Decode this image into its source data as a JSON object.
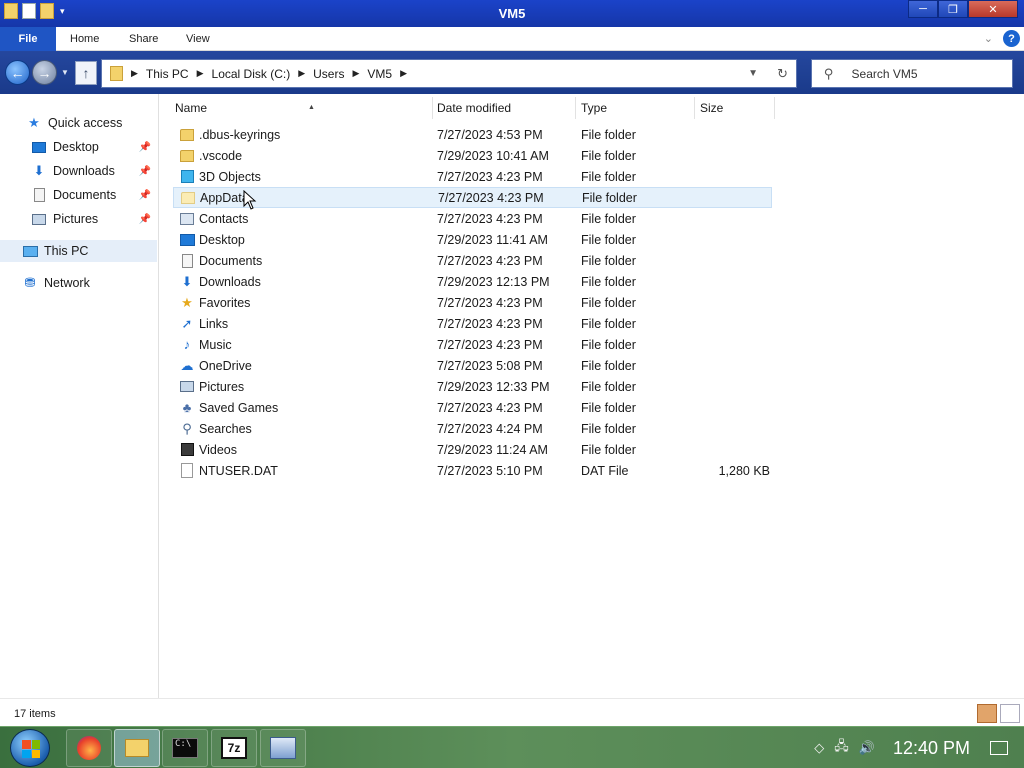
{
  "window": {
    "title": "VM5",
    "minimize_label": "─",
    "restore_label": "❐",
    "close_label": "✕"
  },
  "ribbon": {
    "tabs": [
      "File",
      "Home",
      "Share",
      "View"
    ],
    "collapse_icon": "chevron-down-icon",
    "help_label": "?"
  },
  "address": {
    "crumbs": [
      "This PC",
      "Local Disk (C:)",
      "Users",
      "VM5"
    ]
  },
  "search": {
    "placeholder": "Search VM5"
  },
  "nav": {
    "quick_access": "Quick access",
    "items": [
      {
        "label": "Desktop",
        "icon": "desktop-icon",
        "pinned": true
      },
      {
        "label": "Downloads",
        "icon": "download-icon",
        "pinned": true
      },
      {
        "label": "Documents",
        "icon": "documents-icon",
        "pinned": true
      },
      {
        "label": "Pictures",
        "icon": "pictures-icon",
        "pinned": true
      }
    ],
    "this_pc": "This PC",
    "network": "Network"
  },
  "columns": [
    "Name",
    "Date modified",
    "Type",
    "Size"
  ],
  "files": [
    {
      "name": ".dbus-keyrings",
      "date": "7/27/2023 4:53 PM",
      "type": "File folder",
      "size": "",
      "icon": "folder-icon"
    },
    {
      "name": ".vscode",
      "date": "7/29/2023 10:41 AM",
      "type": "File folder",
      "size": "",
      "icon": "folder-icon"
    },
    {
      "name": "3D Objects",
      "date": "7/27/2023 4:23 PM",
      "type": "File folder",
      "size": "",
      "icon": "3d-objects-icon"
    },
    {
      "name": "AppData",
      "date": "7/27/2023 4:23 PM",
      "type": "File folder",
      "size": "",
      "icon": "folder-icon"
    },
    {
      "name": "Contacts",
      "date": "7/27/2023 4:23 PM",
      "type": "File folder",
      "size": "",
      "icon": "contacts-icon"
    },
    {
      "name": "Desktop",
      "date": "7/29/2023 11:41 AM",
      "type": "File folder",
      "size": "",
      "icon": "desktop-icon"
    },
    {
      "name": "Documents",
      "date": "7/27/2023 4:23 PM",
      "type": "File folder",
      "size": "",
      "icon": "documents-icon"
    },
    {
      "name": "Downloads",
      "date": "7/29/2023 12:13 PM",
      "type": "File folder",
      "size": "",
      "icon": "download-icon"
    },
    {
      "name": "Favorites",
      "date": "7/27/2023 4:23 PM",
      "type": "File folder",
      "size": "",
      "icon": "favorites-icon"
    },
    {
      "name": "Links",
      "date": "7/27/2023 4:23 PM",
      "type": "File folder",
      "size": "",
      "icon": "links-icon"
    },
    {
      "name": "Music",
      "date": "7/27/2023 4:23 PM",
      "type": "File folder",
      "size": "",
      "icon": "music-icon"
    },
    {
      "name": "OneDrive",
      "date": "7/27/2023 5:08 PM",
      "type": "File folder",
      "size": "",
      "icon": "onedrive-icon"
    },
    {
      "name": "Pictures",
      "date": "7/29/2023 12:33 PM",
      "type": "File folder",
      "size": "",
      "icon": "pictures-icon"
    },
    {
      "name": "Saved Games",
      "date": "7/27/2023 4:23 PM",
      "type": "File folder",
      "size": "",
      "icon": "saved-games-icon"
    },
    {
      "name": "Searches",
      "date": "7/27/2023 4:24 PM",
      "type": "File folder",
      "size": "",
      "icon": "search-icon"
    },
    {
      "name": "Videos",
      "date": "7/29/2023 11:24 AM",
      "type": "File folder",
      "size": "",
      "icon": "videos-icon"
    },
    {
      "name": "NTUSER.DAT",
      "date": "7/27/2023 5:10 PM",
      "type": "DAT File",
      "size": "1,280 KB",
      "icon": "file-icon"
    }
  ],
  "status": {
    "item_count": "17 items"
  },
  "taskbar": {
    "apps": [
      {
        "name": "firefox",
        "active": false
      },
      {
        "name": "file-explorer",
        "active": true
      },
      {
        "name": "command-prompt",
        "active": false
      },
      {
        "name": "7-zip",
        "active": false,
        "label": "7z"
      },
      {
        "name": "network-app",
        "active": false
      }
    ],
    "clock": "12:40 PM"
  }
}
